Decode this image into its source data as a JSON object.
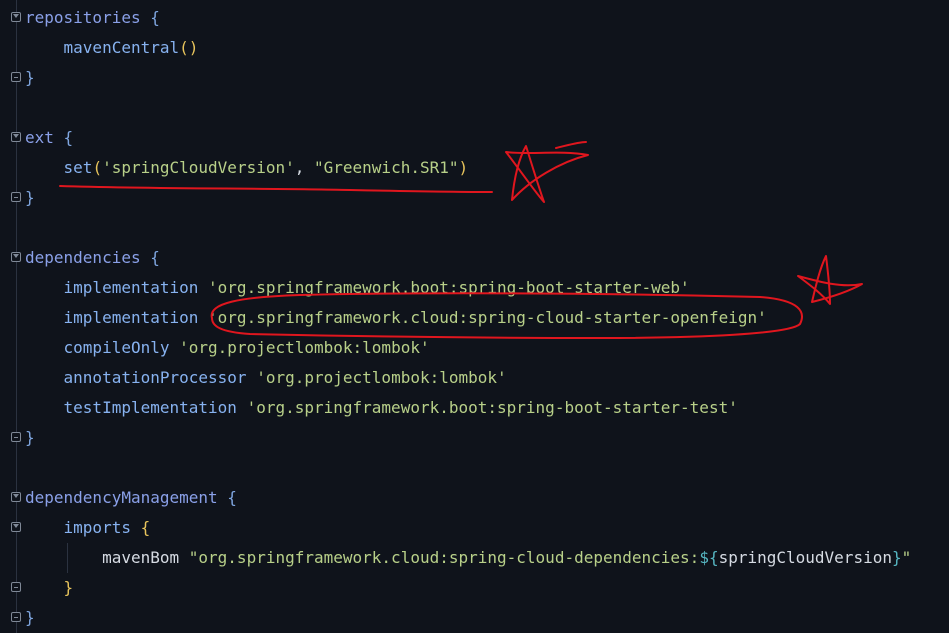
{
  "code": {
    "repositories_kw": "repositories",
    "open_brace": "{",
    "close_brace": "}",
    "maven_central": "mavenCentral",
    "parens": "()",
    "ext_kw": "ext",
    "set_fn": "set",
    "open_paren": "(",
    "close_paren": ")",
    "spring_cloud_version_key": "'springCloudVersion'",
    "comma": ", ",
    "spring_cloud_version_value": "\"Greenwich.SR1\"",
    "dependencies_kw": "dependencies",
    "deps": [
      {
        "config": "implementation",
        "value": "'org.springframework.boot:spring-boot-starter-web'"
      },
      {
        "config": "implementation",
        "value": "'org.springframework.cloud:spring-cloud-starter-openfeign'"
      },
      {
        "config": "compileOnly",
        "value": "'org.projectlombok:lombok'"
      },
      {
        "config": "annotationProcessor",
        "value": "'org.projectlombok:lombok'"
      },
      {
        "config": "testImplementation",
        "value": "'org.springframework.boot:spring-boot-starter-test'"
      }
    ],
    "dependency_management_kw": "dependencyManagement",
    "imports_kw": "imports",
    "maven_bom": "mavenBom",
    "bom_prefix": "\"org.springframework.cloud:spring-cloud-dependencies:",
    "interp_open": "${",
    "interp_var": "springCloudVersion",
    "interp_close": "}",
    "bom_suffix": "\""
  },
  "colors": {
    "background": "#0f131b",
    "annotation": "#e0161e"
  },
  "icons": [
    "fold-open-icon",
    "fold-close-icon"
  ]
}
